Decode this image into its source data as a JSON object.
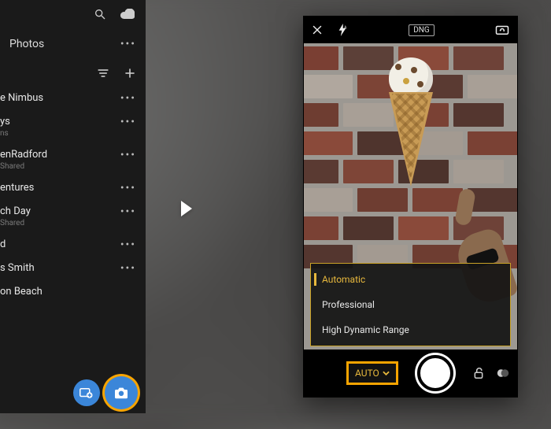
{
  "left": {
    "header_label": "Photos",
    "items": [
      {
        "title": "e Nimbus",
        "sub": ""
      },
      {
        "title": "ys",
        "sub": "ns"
      },
      {
        "title": "enRadford",
        "sub": "Shared"
      },
      {
        "title": "entures",
        "sub": ""
      },
      {
        "title": "ch Day",
        "sub": "Shared"
      },
      {
        "title": "d",
        "sub": ""
      },
      {
        "title": "s Smith",
        "sub": ""
      },
      {
        "title": "on Beach",
        "sub": ""
      }
    ]
  },
  "camera": {
    "dng_label": "DNG",
    "mode_button": "AUTO",
    "modes": {
      "automatic": "Automatic",
      "professional": "Professional",
      "hdr": "High Dynamic Range"
    }
  },
  "colors": {
    "accent_blue": "#3b86d9",
    "accent_amber": "#f7a400",
    "menu_gold": "#e7b83d"
  }
}
